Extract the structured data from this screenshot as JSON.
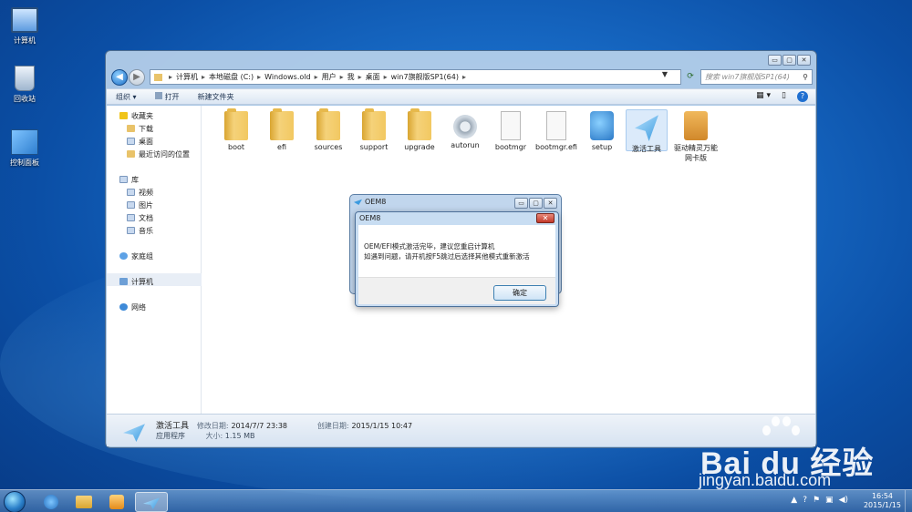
{
  "desktop": {
    "icons": [
      {
        "label": "计算机"
      },
      {
        "label": "回收站"
      },
      {
        "label": "控制面板"
      }
    ]
  },
  "explorer": {
    "window_controls": {
      "minimize": "▭",
      "maximize": "▢",
      "close": "✕"
    },
    "breadcrumb": [
      "计算机",
      "本地磁盘 (C:)",
      "Windows.old",
      "用户",
      "我",
      "桌面",
      "win7旗舰版SP1(64)"
    ],
    "search_placeholder": "搜索 win7旗舰版SP1(64)",
    "toolbar": {
      "organize": "组织 ▾",
      "open": "打开",
      "new_folder": "新建文件夹"
    },
    "nav": {
      "favorites": "收藏夹",
      "downloads": "下载",
      "desktop": "桌面",
      "recent": "最近访问的位置",
      "libraries": "库",
      "videos": "视频",
      "pictures": "图片",
      "documents": "文档",
      "music": "音乐",
      "homegroup": "家庭组",
      "computer": "计算机",
      "network": "网络"
    },
    "files": [
      {
        "name": "boot",
        "icon": "folder-icon"
      },
      {
        "name": "efi",
        "icon": "folder-icon"
      },
      {
        "name": "sources",
        "icon": "folder-icon"
      },
      {
        "name": "support",
        "icon": "folder-icon"
      },
      {
        "name": "upgrade",
        "icon": "folder-icon"
      },
      {
        "name": "autorun",
        "icon": "gear-icon"
      },
      {
        "name": "bootmgr",
        "icon": "file-icon"
      },
      {
        "name": "bootmgr.efi",
        "icon": "file-icon"
      },
      {
        "name": "setup",
        "icon": "setup-icon"
      },
      {
        "name": "激活工具",
        "icon": "plane-icon"
      },
      {
        "name": "驱动精灵万能网卡版",
        "icon": "box-icon"
      }
    ],
    "details": {
      "name": "激活工具",
      "modified_label": "修改日期:",
      "modified": "2014/7/7 23:38",
      "created_label": "创建日期:",
      "created": "2015/1/15 10:47",
      "type": "应用程序",
      "size_label": "大小:",
      "size": "1.15 MB"
    }
  },
  "dialog_back": {
    "title": "OEM8"
  },
  "dialog": {
    "title": "OEM8",
    "line1": "OEM/EFI模式激活完毕，建议您重启计算机",
    "line2": "如遇到问题，请开机按F5跳过后选择其他模式重新激活",
    "ok_label": "确定",
    "close_label": "✕"
  },
  "taskbar": {
    "time": "16:54",
    "date": "2015/1/15"
  },
  "watermark": {
    "brand": "Bai du 经验",
    "url": "jingyan.baidu.com"
  }
}
